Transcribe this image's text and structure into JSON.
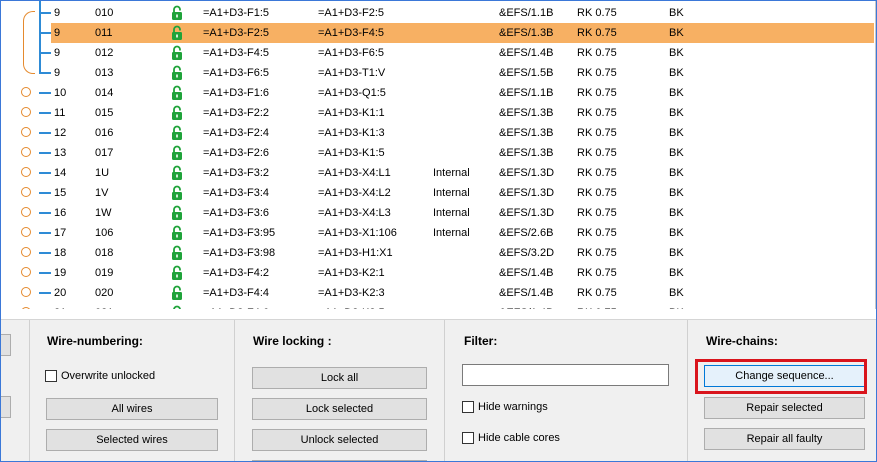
{
  "wire_rows": [
    {
      "num": "9",
      "wire": "010",
      "src": "=A1+D3-F1:5",
      "dst": "=A1+D3-F2:5",
      "int": "",
      "sheet": "&EFS/1.1B",
      "type": "RK 0.75",
      "color": "BK",
      "marker": "chain"
    },
    {
      "num": "9",
      "wire": "011",
      "src": "=A1+D3-F2:5",
      "dst": "=A1+D3-F4:5",
      "int": "",
      "sheet": "&EFS/1.3B",
      "type": "RK 0.75",
      "color": "BK",
      "marker": "chain",
      "selected": true
    },
    {
      "num": "9",
      "wire": "012",
      "src": "=A1+D3-F4:5",
      "dst": "=A1+D3-F6:5",
      "int": "",
      "sheet": "&EFS/1.4B",
      "type": "RK 0.75",
      "color": "BK",
      "marker": "chain"
    },
    {
      "num": "9",
      "wire": "013",
      "src": "=A1+D3-F6:5",
      "dst": "=A1+D3-T1:V",
      "int": "",
      "sheet": "&EFS/1.5B",
      "type": "RK 0.75",
      "color": "BK",
      "marker": "chain"
    },
    {
      "num": "10",
      "wire": "014",
      "src": "=A1+D3-F1:6",
      "dst": "=A1+D3-Q1:5",
      "int": "",
      "sheet": "&EFS/1.1B",
      "type": "RK 0.75",
      "color": "BK",
      "marker": "circle"
    },
    {
      "num": "11",
      "wire": "015",
      "src": "=A1+D3-F2:2",
      "dst": "=A1+D3-K1:1",
      "int": "",
      "sheet": "&EFS/1.3B",
      "type": "RK 0.75",
      "color": "BK",
      "marker": "circle"
    },
    {
      "num": "12",
      "wire": "016",
      "src": "=A1+D3-F2:4",
      "dst": "=A1+D3-K1:3",
      "int": "",
      "sheet": "&EFS/1.3B",
      "type": "RK 0.75",
      "color": "BK",
      "marker": "circle"
    },
    {
      "num": "13",
      "wire": "017",
      "src": "=A1+D3-F2:6",
      "dst": "=A1+D3-K1:5",
      "int": "",
      "sheet": "&EFS/1.3B",
      "type": "RK 0.75",
      "color": "BK",
      "marker": "circle"
    },
    {
      "num": "14",
      "wire": "1U",
      "src": "=A1+D3-F3:2",
      "dst": "=A1+D3-X4:L1",
      "int": "Internal",
      "sheet": "&EFS/1.3D",
      "type": "RK 0.75",
      "color": "BK",
      "marker": "circle"
    },
    {
      "num": "15",
      "wire": "1V",
      "src": "=A1+D3-F3:4",
      "dst": "=A1+D3-X4:L2",
      "int": "Internal",
      "sheet": "&EFS/1.3D",
      "type": "RK 0.75",
      "color": "BK",
      "marker": "circle"
    },
    {
      "num": "16",
      "wire": "1W",
      "src": "=A1+D3-F3:6",
      "dst": "=A1+D3-X4:L3",
      "int": "Internal",
      "sheet": "&EFS/1.3D",
      "type": "RK 0.75",
      "color": "BK",
      "marker": "circle"
    },
    {
      "num": "17",
      "wire": "106",
      "src": "=A1+D3-F3:95",
      "dst": "=A1+D3-X1:106",
      "int": "Internal",
      "sheet": "&EFS/2.6B",
      "type": "RK 0.75",
      "color": "BK",
      "marker": "circle"
    },
    {
      "num": "18",
      "wire": "018",
      "src": "=A1+D3-F3:98",
      "dst": "=A1+D3-H1:X1",
      "int": "",
      "sheet": "&EFS/3.2D",
      "type": "RK 0.75",
      "color": "BK",
      "marker": "circle"
    },
    {
      "num": "19",
      "wire": "019",
      "src": "=A1+D3-F4:2",
      "dst": "=A1+D3-K2:1",
      "int": "",
      "sheet": "&EFS/1.4B",
      "type": "RK 0.75",
      "color": "BK",
      "marker": "circle"
    },
    {
      "num": "20",
      "wire": "020",
      "src": "=A1+D3-F4:4",
      "dst": "=A1+D3-K2:3",
      "int": "",
      "sheet": "&EFS/1.4B",
      "type": "RK 0.75",
      "color": "BK",
      "marker": "circle"
    },
    {
      "num": "21",
      "wire": "021",
      "src": "=A1+D3-F4:6",
      "dst": "=A1+D3-K2:5",
      "int": "",
      "sheet": "&EFS/1.4B",
      "type": "RK 0.75",
      "color": "BK",
      "marker": "circle"
    }
  ],
  "wire_numbering": {
    "title": "Wire-numbering:",
    "overwrite_unlocked": "Overwrite unlocked",
    "all_wires": "All wires",
    "selected_wires": "Selected wires"
  },
  "wire_locking": {
    "title": "Wire locking :",
    "lock_all": "Lock all",
    "lock_selected": "Lock selected",
    "unlock_selected": "Unlock selected"
  },
  "filter": {
    "title": "Filter:",
    "text_value": "",
    "hide_warnings": "Hide warnings",
    "hide_cable_cores": "Hide cable cores"
  },
  "wire_chains": {
    "title": "Wire-chains:",
    "change_sequence": "Change sequence...",
    "repair_selected": "Repair selected",
    "repair_all_faulty": "Repair all faulty"
  },
  "colors": {
    "selection": "#f7b063",
    "lock_icon": "#1fa33a",
    "chain_marker": "#e58a2e",
    "tree_line": "#2e8bd6",
    "callout": "#d9141c"
  }
}
